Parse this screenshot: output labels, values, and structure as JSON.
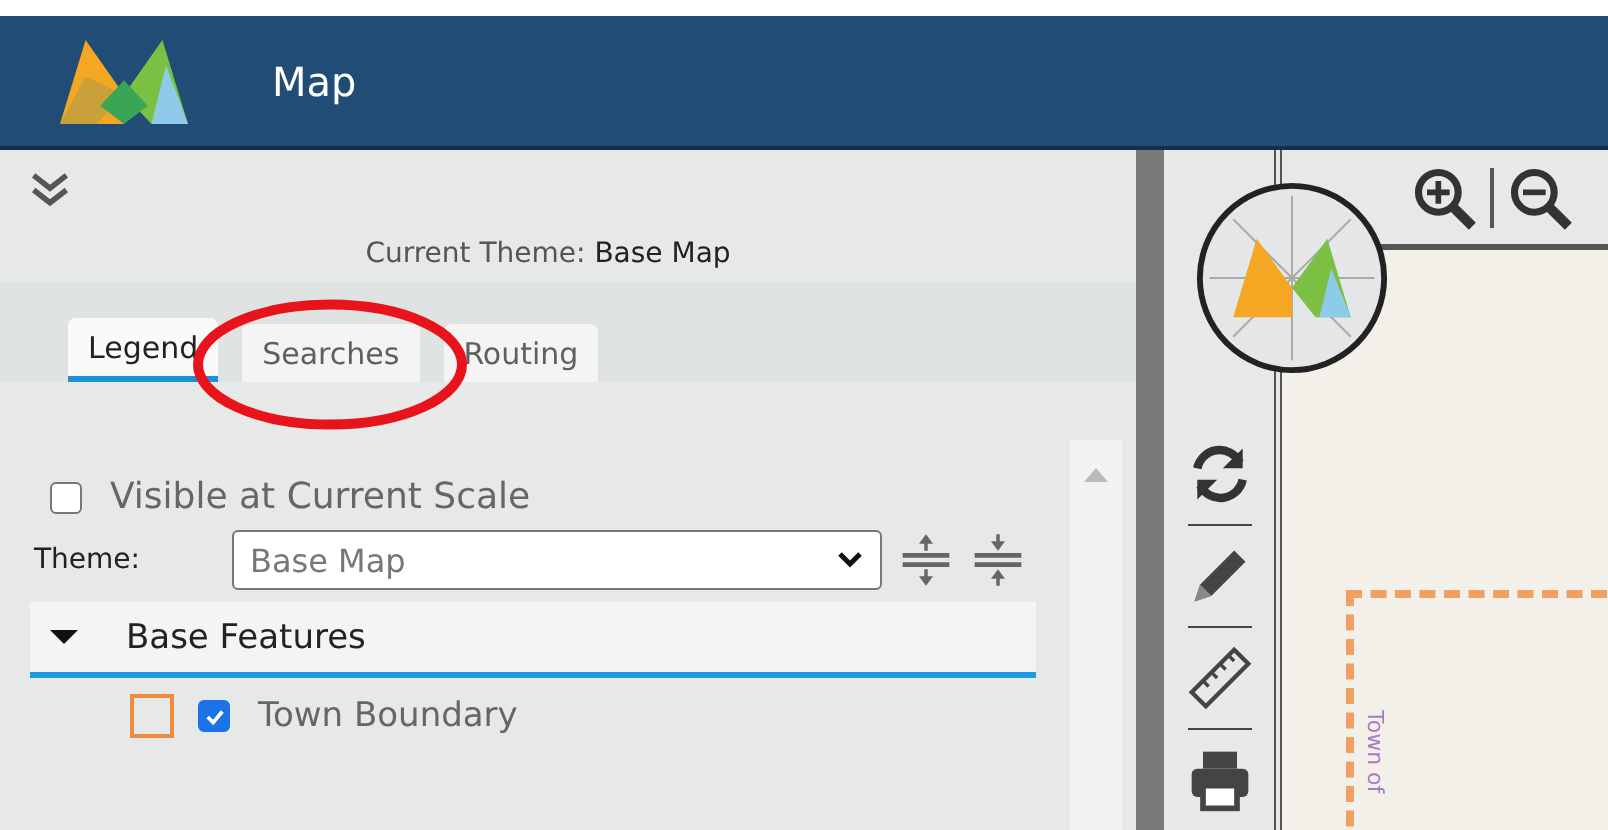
{
  "header": {
    "title": "Map"
  },
  "panel": {
    "current_theme": "Current Theme: **Base Map**",
    "tabs": [
      {
        "label": "Legend",
        "selected": true
      },
      {
        "label": "Searches",
        "selected": false
      },
      {
        "label": "Routing",
        "selected": false
      }
    ],
    "visible_at_scale": {
      "label": "Visible at Current Scale",
      "checked": false
    },
    "theme": {
      "label": "Theme:",
      "value": "Base Map"
    },
    "groups": [
      {
        "label": "Base Features",
        "expanded": true,
        "layers": [
          {
            "label": "Town Boundary",
            "checked": true,
            "color": "#f08a3c"
          }
        ]
      }
    ]
  },
  "map": {
    "labels": [
      "Town of"
    ]
  }
}
